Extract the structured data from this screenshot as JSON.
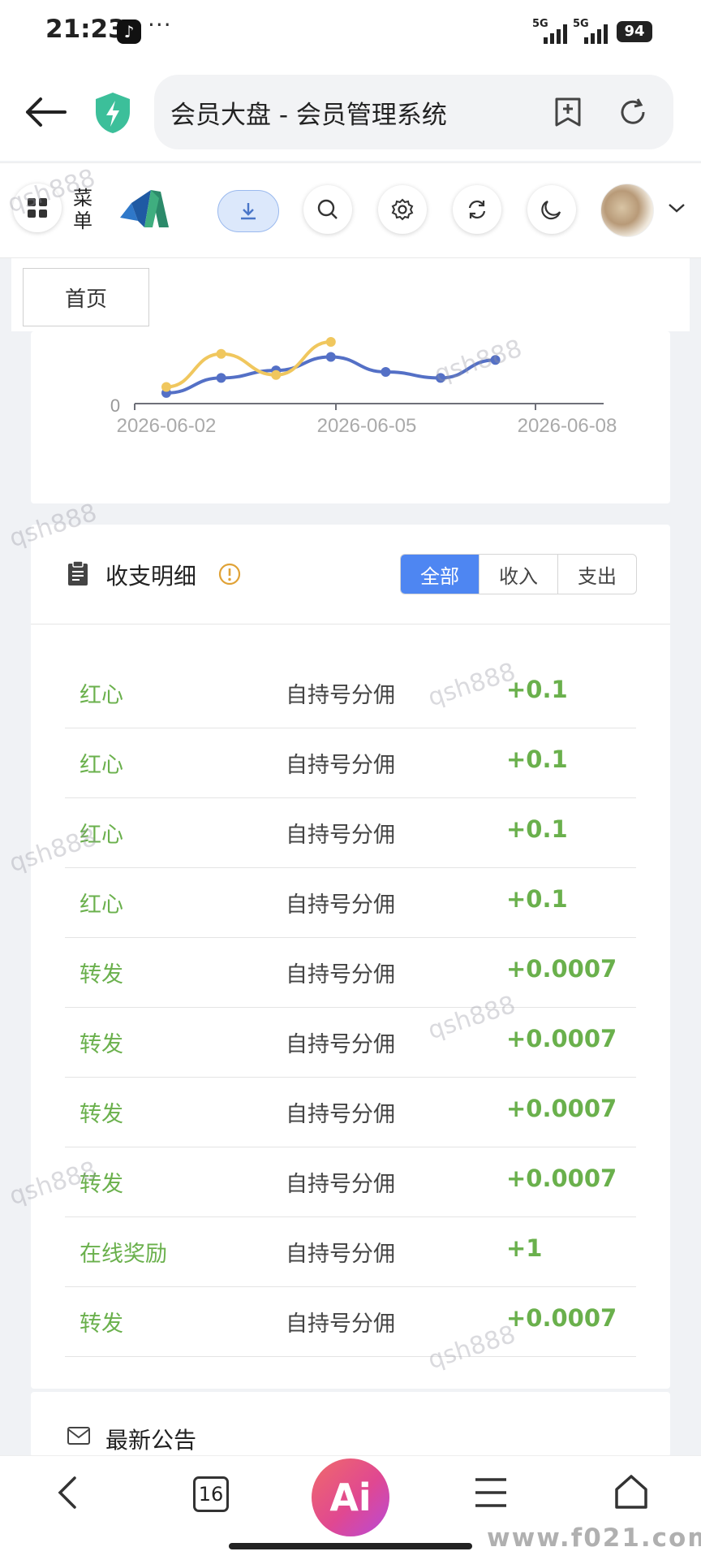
{
  "status_bar": {
    "time": "21:23",
    "more": "···",
    "net1": "5G",
    "net2": "5G",
    "battery": "94"
  },
  "browser": {
    "url_title": "会员大盘 - 会员管理系统",
    "tab_count": "16",
    "ai_label": "Ai"
  },
  "header": {
    "menu_label": "菜单"
  },
  "tabs": {
    "home": "首页"
  },
  "chart_data": {
    "type": "line",
    "x": [
      "2026-06-02",
      "2026-06-03",
      "2026-06-04",
      "2026-06-05",
      "2026-06-06",
      "2026-06-07",
      "2026-06-08"
    ],
    "tick_labels": [
      "2026-06-02",
      "2026-06-05",
      "2026-06-08"
    ],
    "y_tick_visible": "0",
    "series": [
      {
        "color": "#5470c6",
        "values": [
          0.3,
          0.8,
          1.05,
          1.5,
          1.0,
          0.8,
          1.4
        ]
      },
      {
        "color": "#f0c75e",
        "values": [
          0.5,
          1.6,
          0.9,
          2.0
        ]
      }
    ]
  },
  "ledger": {
    "title": "收支明细",
    "filters": [
      "全部",
      "收入",
      "支出"
    ],
    "rows": [
      {
        "type": "红心",
        "desc": "自持号分佣",
        "amount": "+0.1"
      },
      {
        "type": "红心",
        "desc": "自持号分佣",
        "amount": "+0.1"
      },
      {
        "type": "红心",
        "desc": "自持号分佣",
        "amount": "+0.1"
      },
      {
        "type": "红心",
        "desc": "自持号分佣",
        "amount": "+0.1"
      },
      {
        "type": "转发",
        "desc": "自持号分佣",
        "amount": "+0.0007"
      },
      {
        "type": "转发",
        "desc": "自持号分佣",
        "amount": "+0.0007"
      },
      {
        "type": "转发",
        "desc": "自持号分佣",
        "amount": "+0.0007"
      },
      {
        "type": "转发",
        "desc": "自持号分佣",
        "amount": "+0.0007"
      },
      {
        "type": "在线奖励",
        "desc": "自持号分佣",
        "amount": "+1"
      },
      {
        "type": "转发",
        "desc": "自持号分佣",
        "amount": "+0.0007"
      }
    ]
  },
  "notice": {
    "title": "最新公告"
  },
  "watermark": "qsh888",
  "site_mark": "www.f021.com",
  "colors": {
    "accent": "#4e86f2",
    "income": "#6ab04c"
  }
}
